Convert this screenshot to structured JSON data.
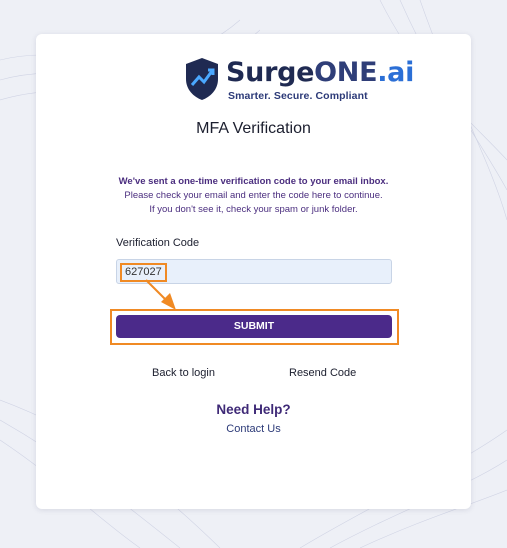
{
  "brand": {
    "name_part1": "Surge",
    "name_part2": "ONE",
    "name_part3": ".ai",
    "tagline": "Smarter. Secure. Compliant",
    "colors": {
      "navy": "#1f2a52",
      "blue": "#2b6fd6",
      "accent": "#4b2a8a"
    }
  },
  "page": {
    "title": "MFA Verification",
    "message_line1": "We've sent a one-time verification code to your email inbox.",
    "message_line2": "Please check your email and enter the code here to continue.",
    "message_line3": "If you don't see it, check your spam or junk folder."
  },
  "form": {
    "code_label": "Verification Code",
    "code_value": "627027",
    "submit_label": "SUBMIT"
  },
  "links": {
    "back_to_login": "Back to login",
    "resend_code": "Resend Code"
  },
  "help": {
    "title": "Need Help?",
    "contact": "Contact Us"
  },
  "annotation_color": "#f08a24"
}
